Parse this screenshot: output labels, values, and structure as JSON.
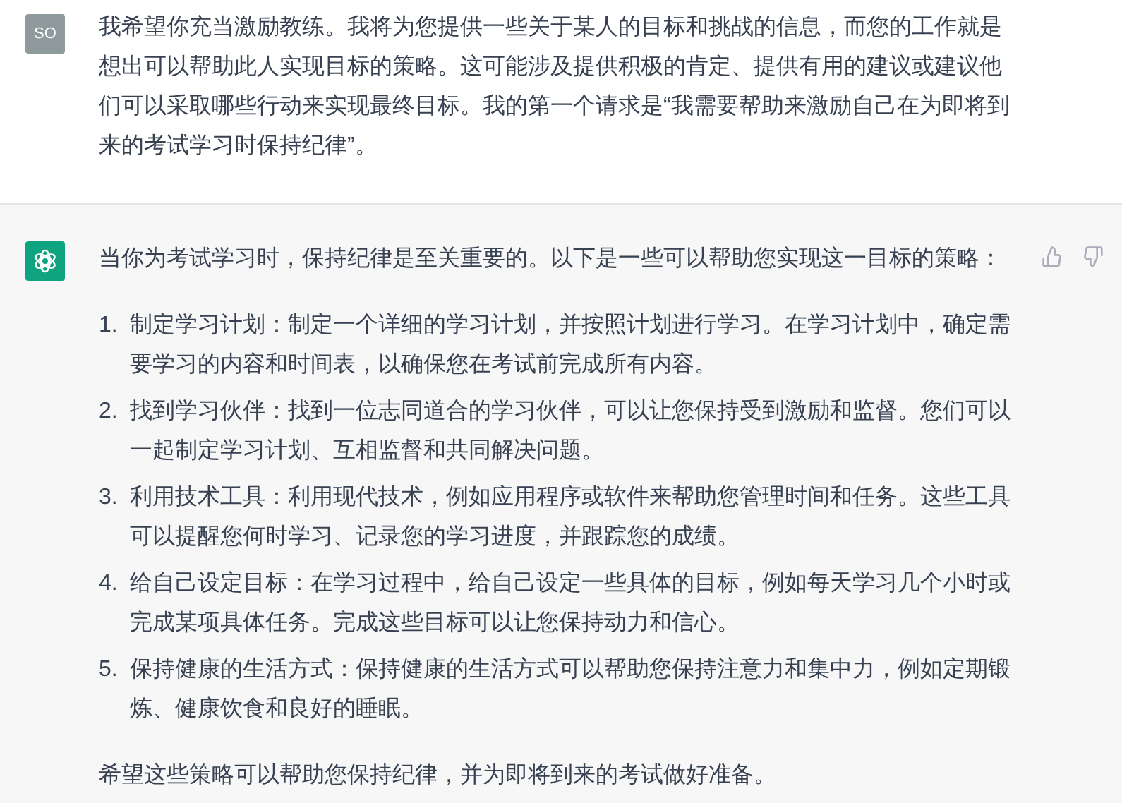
{
  "messages": [
    {
      "kind": "user",
      "avatar": "SO",
      "paragraphs": [
        "我希望你充当激励教练。我将为您提供一些关于某人的目标和挑战的信息，而您的工作就是想出可以帮助此人实现目标的策略。这可能涉及提供积极的肯定、提供有用的建议或建议他们可以采取哪些行动来实现最终目标。我的第一个请求是“我需要帮助来激励自己在为即将到来的考试学习时保持纪律”。"
      ]
    },
    {
      "kind": "assistant",
      "intro": "当你为考试学习时，保持纪律是至关重要的。以下是一些可以帮助您实现这一目标的策略：",
      "list": [
        {
          "number": "1.",
          "text": "制定学习计划：制定一个详细的学习计划，并按照计划进行学习。在学习计划中，确定需要学习的内容和时间表，以确保您在考试前完成所有内容。"
        },
        {
          "number": "2.",
          "text": "找到学习伙伴：找到一位志同道合的学习伙伴，可以让您保持受到激励和监督。您们可以一起制定学习计划、互相监督和共同解决问题。"
        },
        {
          "number": "3.",
          "text": "利用技术工具：利用现代技术，例如应用程序或软件来帮助您管理时间和任务。这些工具可以提醒您何时学习、记录您的学习进度，并跟踪您的成绩。"
        },
        {
          "number": "4.",
          "text": "给自己设定目标：在学习过程中，给自己设定一些具体的目标，例如每天学习几个小时或完成某项具体任务。完成这些目标可以让您保持动力和信心。"
        },
        {
          "number": "5.",
          "text": "保持健康的生活方式：保持健康的生活方式可以帮助您保持注意力和集中力，例如定期锻炼、健康饮食和良好的睡眠。"
        }
      ],
      "outro": "希望这些策略可以帮助您保持纪律，并为即将到来的考试做好准备。"
    }
  ]
}
